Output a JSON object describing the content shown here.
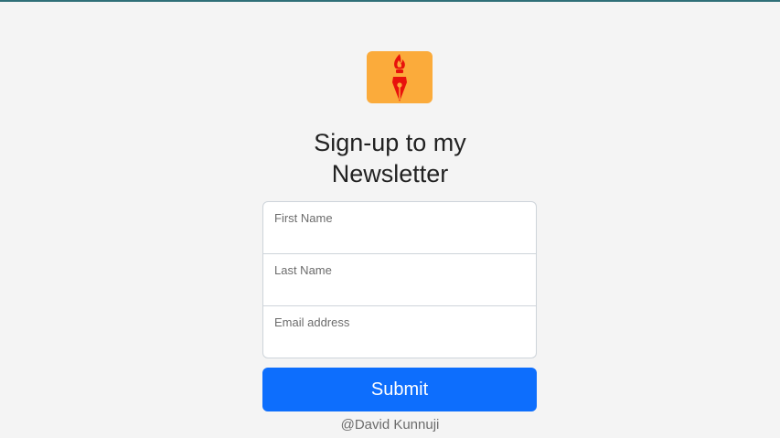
{
  "brand": {
    "logo_icon": "fountain-pen-flame-icon",
    "logo_bg_color": "#fbab3b",
    "logo_fg_color": "#e8120c"
  },
  "heading": {
    "line1": "Sign-up to my",
    "line2": "Newsletter"
  },
  "form": {
    "fields": [
      {
        "label": "First Name",
        "value": ""
      },
      {
        "label": "Last Name",
        "value": ""
      },
      {
        "label": "Email address",
        "value": ""
      }
    ],
    "submit_label": "Submit",
    "submit_color": "#0d6efd"
  },
  "footer": {
    "credit": "@David Kunnuji"
  }
}
